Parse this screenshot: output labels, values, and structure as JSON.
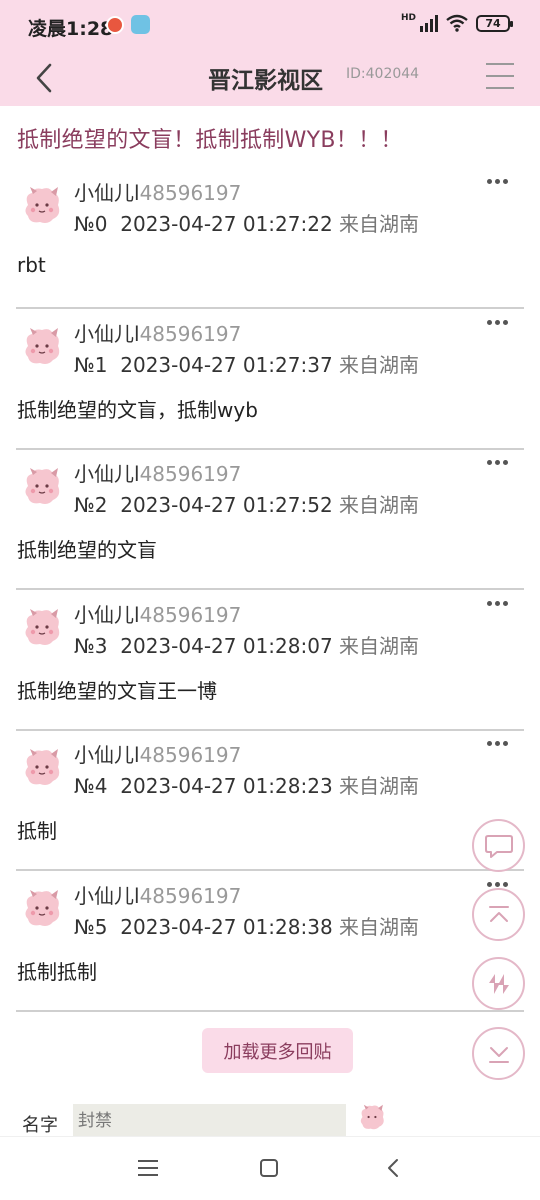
{
  "status_bar": {
    "time": "凌晨1:28",
    "battery": "74",
    "network": "HD"
  },
  "header": {
    "title": "晋江影视区",
    "id_text": "ID:402044"
  },
  "thread": {
    "title": "抵制绝望的文盲！抵制抵制WYB！！！"
  },
  "posts": [
    {
      "nick": "小仙儿l",
      "uid": "48596197",
      "floor": "№0",
      "datetime": "2023-04-27 01:27:22",
      "location": "来自湖南",
      "content": "rbt"
    },
    {
      "nick": "小仙儿l",
      "uid": "48596197",
      "floor": "№1",
      "datetime": "2023-04-27 01:27:37",
      "location": "来自湖南",
      "content": "抵制绝望的文盲，抵制wyb"
    },
    {
      "nick": "小仙儿l",
      "uid": "48596197",
      "floor": "№2",
      "datetime": "2023-04-27 01:27:52",
      "location": "来自湖南",
      "content": "抵制绝望的文盲"
    },
    {
      "nick": "小仙儿l",
      "uid": "48596197",
      "floor": "№3",
      "datetime": "2023-04-27 01:28:07",
      "location": "来自湖南",
      "content": "抵制绝望的文盲王一博"
    },
    {
      "nick": "小仙儿l",
      "uid": "48596197",
      "floor": "№4",
      "datetime": "2023-04-27 01:28:23",
      "location": "来自湖南",
      "content": "抵制"
    },
    {
      "nick": "小仙儿l",
      "uid": "48596197",
      "floor": "№5",
      "datetime": "2023-04-27 01:28:38",
      "location": "来自湖南",
      "content": "抵制抵制"
    }
  ],
  "load_more": {
    "label": "加载更多回贴"
  },
  "reply_form": {
    "name_label": "名字",
    "name_placeholder": "封禁"
  },
  "floating_buttons": [
    {
      "icon": "comment-icon"
    },
    {
      "icon": "scroll-top-icon"
    },
    {
      "icon": "refresh-icon"
    },
    {
      "icon": "scroll-bottom-icon"
    }
  ],
  "colors": {
    "header_bg": "#fadbe8",
    "accent_text": "#8a3d5e",
    "fab_border": "#e4b8c8"
  }
}
